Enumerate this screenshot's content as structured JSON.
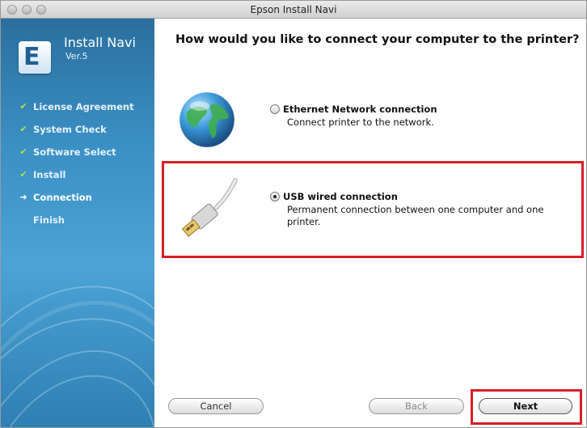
{
  "window": {
    "title": "Epson Install Navi"
  },
  "sidebar": {
    "app_name": "Install Navi",
    "version": "Ver.5",
    "steps": [
      {
        "label": "License Agreement",
        "state": "done",
        "icon": "check-icon"
      },
      {
        "label": "System Check",
        "state": "done",
        "icon": "check-icon"
      },
      {
        "label": "Software Select",
        "state": "done",
        "icon": "check-icon"
      },
      {
        "label": "Install",
        "state": "done",
        "icon": "check-icon"
      },
      {
        "label": "Connection",
        "state": "current",
        "icon": "arrow-right-icon"
      },
      {
        "label": "Finish",
        "state": "pending",
        "icon": ""
      }
    ]
  },
  "main": {
    "title": "How would you like to connect your computer to the printer?",
    "options": [
      {
        "title": "Ethernet Network connection",
        "description": "Connect printer to the network.",
        "selected": false,
        "icon": "globe-icon"
      },
      {
        "title": "USB wired connection",
        "description": "Permanent connection between one computer and one printer.",
        "selected": true,
        "icon": "usb-cable-icon"
      }
    ]
  },
  "buttons": {
    "cancel": "Cancel",
    "back": "Back",
    "next": "Next"
  },
  "colors": {
    "highlight": "#d71f26",
    "sidebar": "#3a8fc3",
    "check": "#b6e04a"
  }
}
